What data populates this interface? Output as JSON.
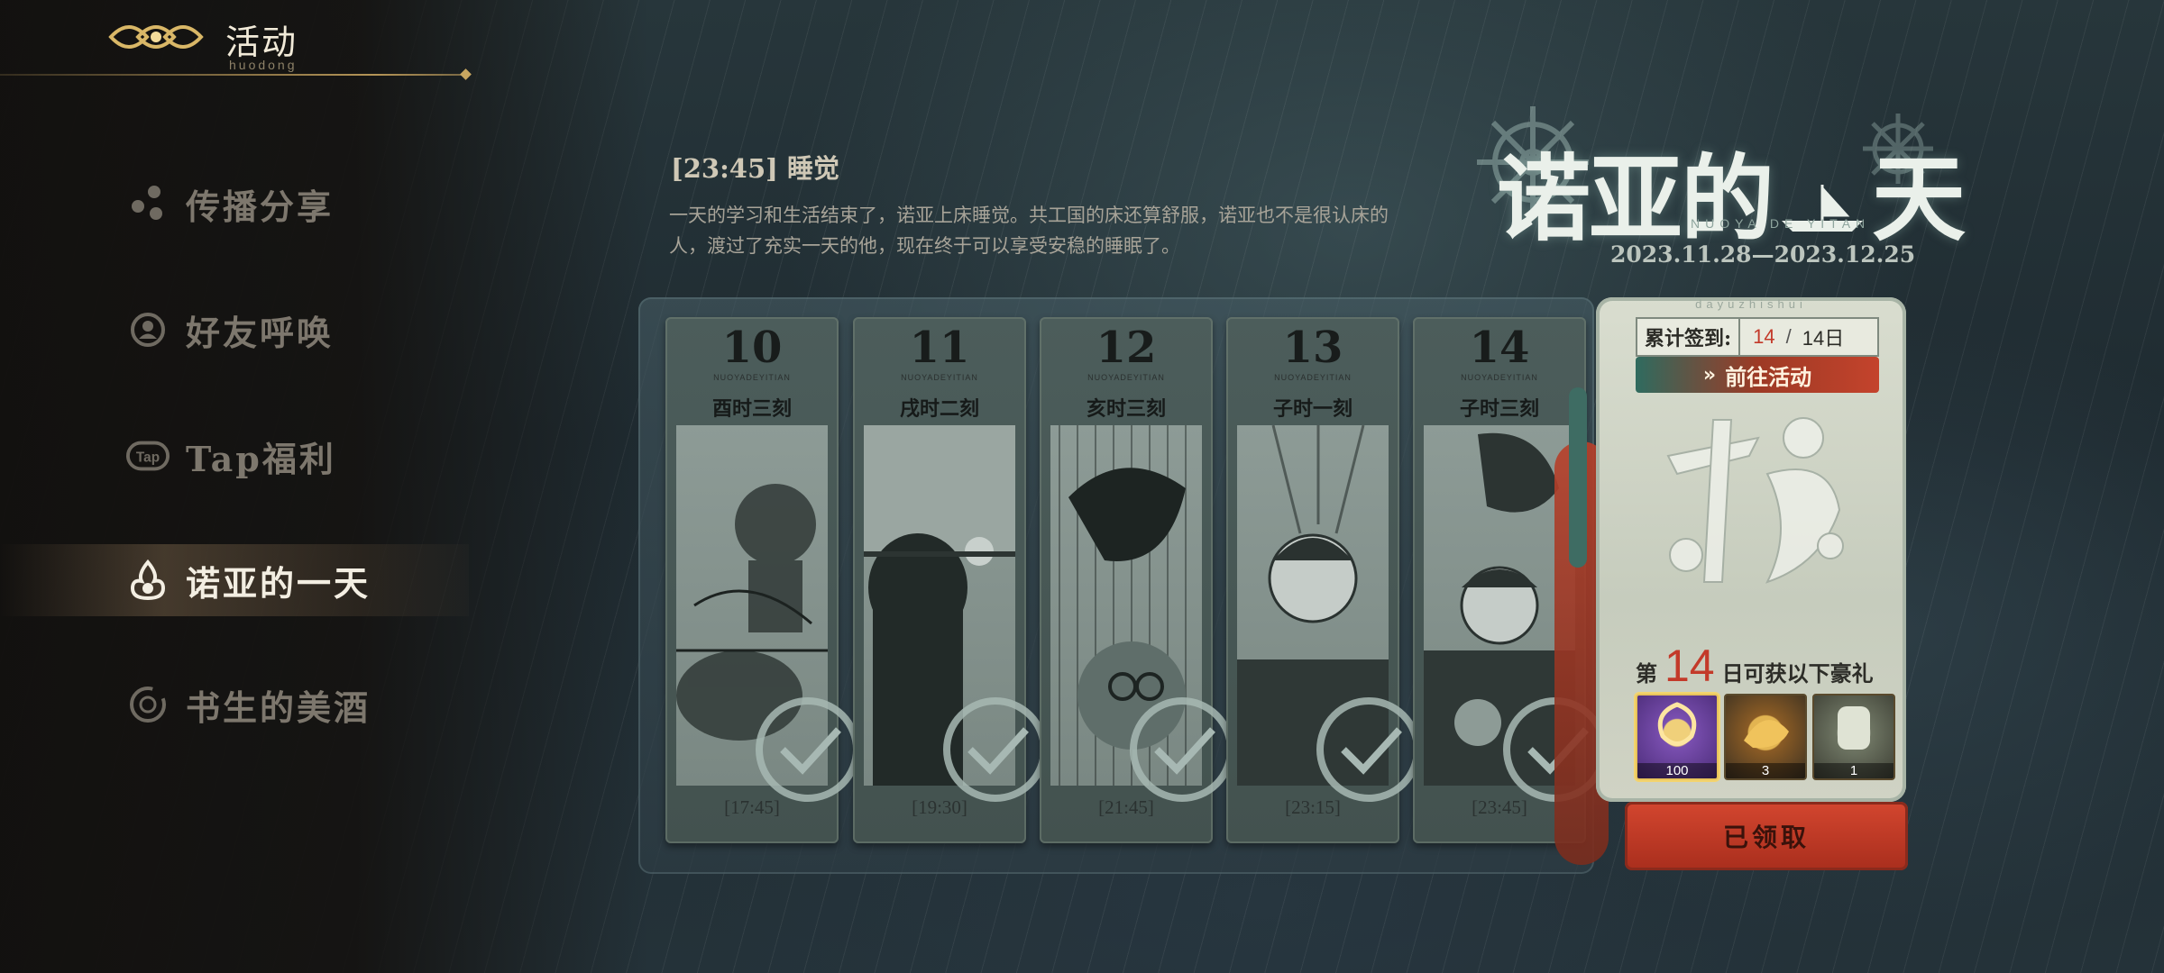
{
  "header": {
    "title": "活动",
    "subtitle": "huodong"
  },
  "sidebar": {
    "items": [
      {
        "label": "传播分享",
        "icon": "share-icon",
        "active": false
      },
      {
        "label": "好友呼唤",
        "icon": "friend-call-icon",
        "active": false
      },
      {
        "label": "Tap福利",
        "icon": "tap-icon",
        "active": false
      },
      {
        "label": "诺亚的一天",
        "icon": "flame-icon",
        "active": true
      },
      {
        "label": "书生的美酒",
        "icon": "ring-icon",
        "active": false
      }
    ]
  },
  "event": {
    "entry_title": "[23:45]  睡觉",
    "entry_body": "一天的学习和生活结束了，诺亚上床睡觉。共工国的床还算舒服，诺亚也不是很认床的人，渡过了充实一天的他，现在终于可以享受安稳的睡眠了。",
    "banner_title": "诺亚的",
    "banner_title_end": "天",
    "banner_pinyin": "NUOYA DE YITAN",
    "date_range": "2023.11.28—2023.12.25"
  },
  "cards": [
    {
      "day": "10",
      "pinyin": "NUOYADEYITIAN",
      "period": "酉时三刻",
      "clock": "[17:45]",
      "done": true
    },
    {
      "day": "11",
      "pinyin": "NUOYADEYITIAN",
      "period": "戌时二刻",
      "clock": "[19:30]",
      "done": true
    },
    {
      "day": "12",
      "pinyin": "NUOYADEYITIAN",
      "period": "亥时三刻",
      "clock": "[21:45]",
      "done": true
    },
    {
      "day": "13",
      "pinyin": "NUOYADEYITIAN",
      "period": "子时一刻",
      "clock": "[23:15]",
      "done": true
    },
    {
      "day": "14",
      "pinyin": "NUOYADEYITIAN",
      "period": "子时三刻",
      "clock": "[23:45]",
      "done": true
    }
  ],
  "panel": {
    "top_pinyin": "dayuzhishui",
    "checkin_label": "累计签到:",
    "checkin_current": "14",
    "checkin_sep": "/",
    "checkin_total": "14日",
    "goto_label": "前往活动",
    "reward_prefix": "第",
    "reward_day": "14",
    "reward_suffix": "日可获以下豪礼",
    "rewards": [
      {
        "qty": "100",
        "icon": "purple-currency-icon"
      },
      {
        "qty": "3",
        "icon": "gold-item-icon"
      },
      {
        "qty": "1",
        "icon": "jade-item-icon"
      }
    ],
    "claimed_label": "已领取"
  },
  "colors": {
    "accent_red": "#c33a2a",
    "gold": "#c9a760",
    "active_text": "#f3eee2",
    "inactive_text": "#7d776d"
  }
}
